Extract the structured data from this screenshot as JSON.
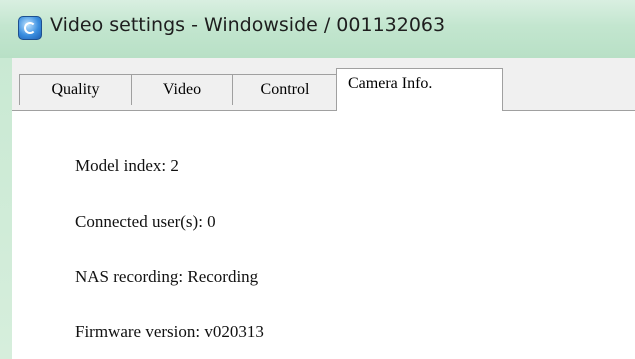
{
  "window": {
    "title": "Video settings - Windowside / 001132063",
    "icon": "camera-app-icon"
  },
  "tabs": [
    {
      "label": "Quality",
      "selected": false
    },
    {
      "label": "Video",
      "selected": false
    },
    {
      "label": "Control",
      "selected": false
    },
    {
      "label": "Camera Info.",
      "selected": true
    }
  ],
  "camera_info": {
    "model_index": "Model index: 2",
    "connected_users": "Connected user(s): 0",
    "nas_recording": "NAS recording: Recording",
    "firmware_version": "Firmware version: v020313"
  }
}
